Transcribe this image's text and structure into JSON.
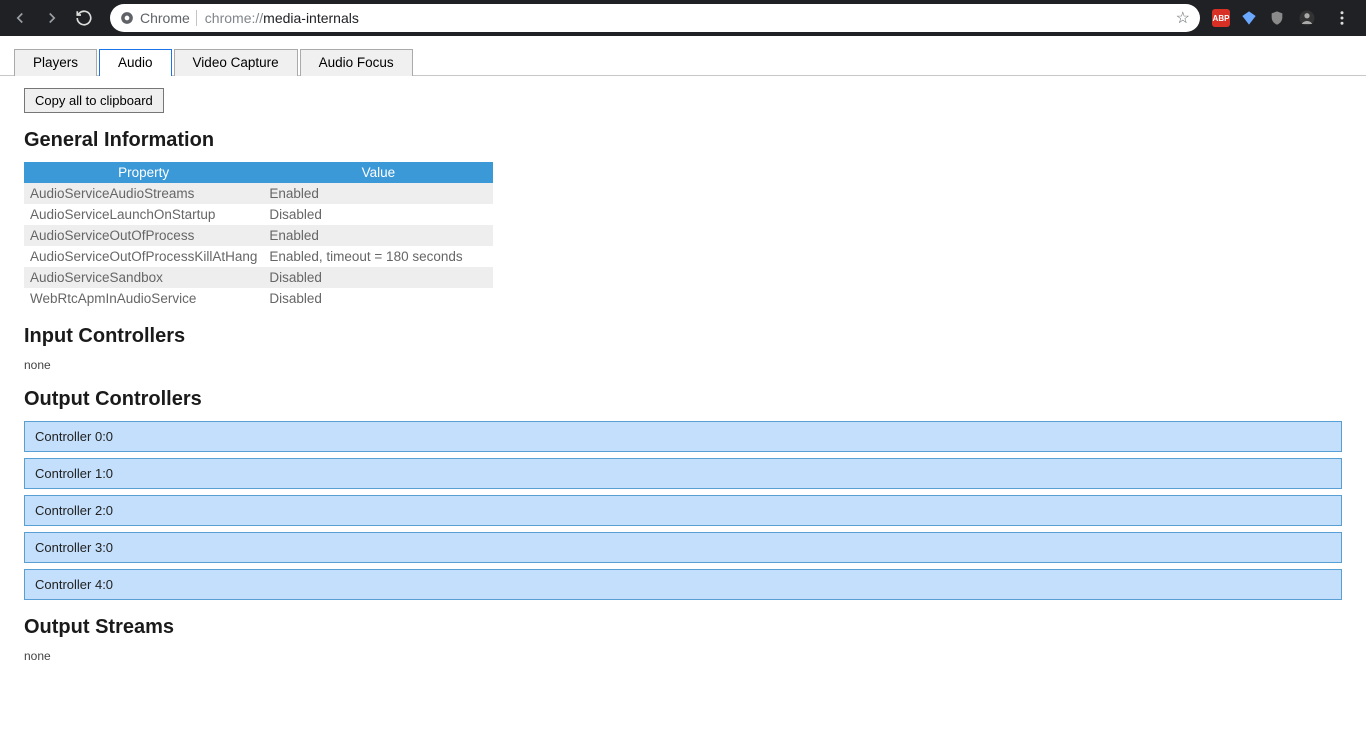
{
  "chrome": {
    "chip_label": "Chrome",
    "url_prefix": "chrome://",
    "url_suffix": "media-internals"
  },
  "tabs": [
    {
      "label": "Players"
    },
    {
      "label": "Audio"
    },
    {
      "label": "Video Capture"
    },
    {
      "label": "Audio Focus"
    }
  ],
  "copy_btn": "Copy all to clipboard",
  "sections": {
    "general": "General Information",
    "input": "Input Controllers",
    "output": "Output Controllers",
    "streams": "Output Streams"
  },
  "table": {
    "headers": [
      "Property",
      "Value"
    ],
    "rows": [
      {
        "prop": "AudioServiceAudioStreams",
        "val": "Enabled"
      },
      {
        "prop": "AudioServiceLaunchOnStartup",
        "val": "Disabled"
      },
      {
        "prop": "AudioServiceOutOfProcess",
        "val": "Enabled"
      },
      {
        "prop": "AudioServiceOutOfProcessKillAtHang",
        "val": "Enabled, timeout = 180 seconds"
      },
      {
        "prop": "AudioServiceSandbox",
        "val": "Disabled"
      },
      {
        "prop": "WebRtcApmInAudioService",
        "val": "Disabled"
      }
    ]
  },
  "input_none": "none",
  "streams_none": "none",
  "controllers": [
    "Controller 0:0",
    "Controller 1:0",
    "Controller 2:0",
    "Controller 3:0",
    "Controller 4:0"
  ]
}
